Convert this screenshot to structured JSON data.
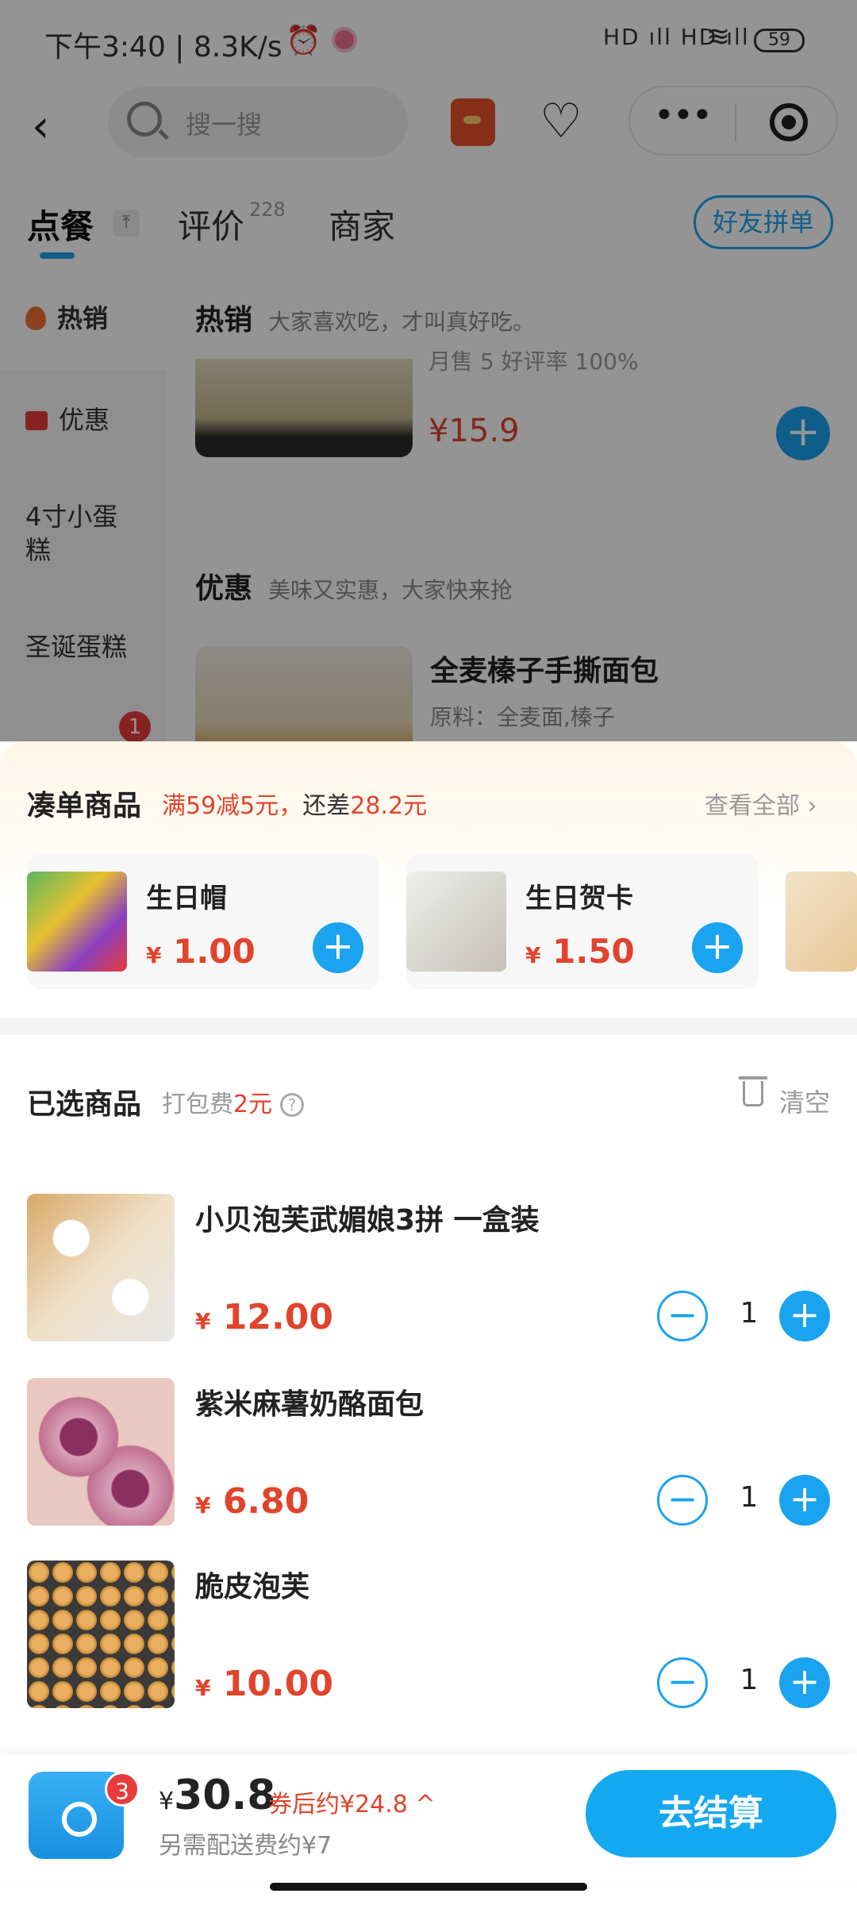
{
  "status_bar": {
    "time": "下午3:40 | 8.3K/s",
    "alarm_icon": "alarm-icon",
    "signal": "HD ıll HD ıll",
    "battery": "59"
  },
  "nav": {
    "search_placeholder": "搜一搜",
    "capsule_dots": "•••"
  },
  "tabs": {
    "order": "点餐",
    "reviews": "评价",
    "reviews_count": "228",
    "merchant": "商家",
    "group_button": "好友拼单"
  },
  "sidebar": {
    "items": [
      {
        "label": "热销"
      },
      {
        "label": "优惠"
      },
      {
        "label": "4寸小蛋糕"
      },
      {
        "label": "圣诞蛋糕"
      }
    ],
    "badge": "1"
  },
  "menu": {
    "hot": {
      "title": "热销",
      "subtitle": "大家喜欢吃，才叫真好吃。",
      "sales": "月售 5 好评率 100%",
      "price": "¥15.9"
    },
    "deal": {
      "title": "优惠",
      "subtitle": "美味又实惠，大家快来抢",
      "product_name": "全麦榛子手撕面包",
      "product_desc": "原料：全麦面,榛子"
    }
  },
  "addon": {
    "title": "凑单商品",
    "promo_prefix": "满59减5元，",
    "promo_mid": "还差",
    "promo_amount": "28.2元",
    "view_all": "查看全部 ›",
    "cards": [
      {
        "name": "生日帽",
        "currency": "¥",
        "price": "1.00"
      },
      {
        "name": "生日贺卡",
        "currency": "¥",
        "price": "1.50"
      }
    ]
  },
  "selected": {
    "title": "已选商品",
    "pack_fee_label": "打包费",
    "pack_fee_value": "2元",
    "clear": "清空",
    "items": [
      {
        "name": "小贝泡芙武媚娘3拼 一盒装",
        "currency": "¥",
        "price": "12.00",
        "qty": "1"
      },
      {
        "name": "紫米麻薯奶酪面包",
        "currency": "¥",
        "price": "6.80",
        "qty": "1"
      },
      {
        "name": "脆皮泡芙",
        "currency": "¥",
        "price": "10.00",
        "qty": "1"
      }
    ]
  },
  "bottom": {
    "cart_count": "3",
    "currency": "¥",
    "total": "30.8",
    "after_coupon": "券后约¥24.8 ^",
    "delivery": "另需配送费约¥7",
    "checkout": "去结算"
  },
  "colors": {
    "accent": "#1aa3ee",
    "price": "#e0442c",
    "badge": "#e83b3b"
  }
}
